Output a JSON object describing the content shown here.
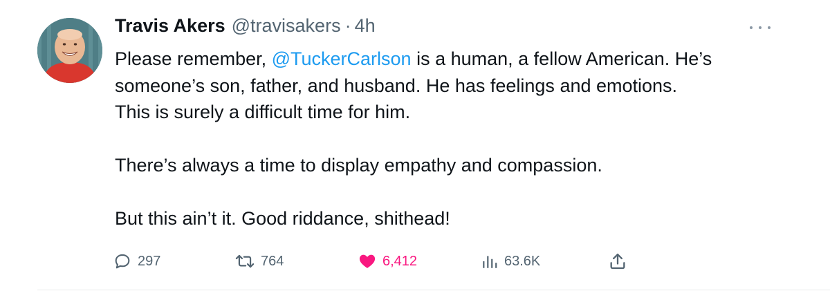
{
  "author": {
    "name": "Travis Akers",
    "handle": "@travisakers",
    "separator": "·",
    "time": "4h",
    "avatar_icon": "profile-photo"
  },
  "tweet": {
    "line1_before": "Please remember, ",
    "mention": "@TuckerCarlson",
    "line1_after": " is a human, a fellow American. He’s",
    "line2": "someone’s son, father, and husband. He has feelings and emotions.",
    "line3": "This is surely a difficult time for him.",
    "line4": "There’s always a time to display empathy and compassion.",
    "line5": "But this ain’t it. Good riddance, shithead!"
  },
  "actions": {
    "replies": "297",
    "retweets": "764",
    "likes": "6,412",
    "views": "63.6K"
  },
  "colors": {
    "text": "#0f1419",
    "secondary": "#536471",
    "mention": "#1d9bf0",
    "like": "#f91880"
  },
  "icons": {
    "more": "more-dots-icon",
    "reply": "reply-bubble-icon",
    "retweet": "retweet-icon",
    "like": "heart-filled-icon",
    "views": "views-bars-icon",
    "share": "share-upload-icon"
  }
}
